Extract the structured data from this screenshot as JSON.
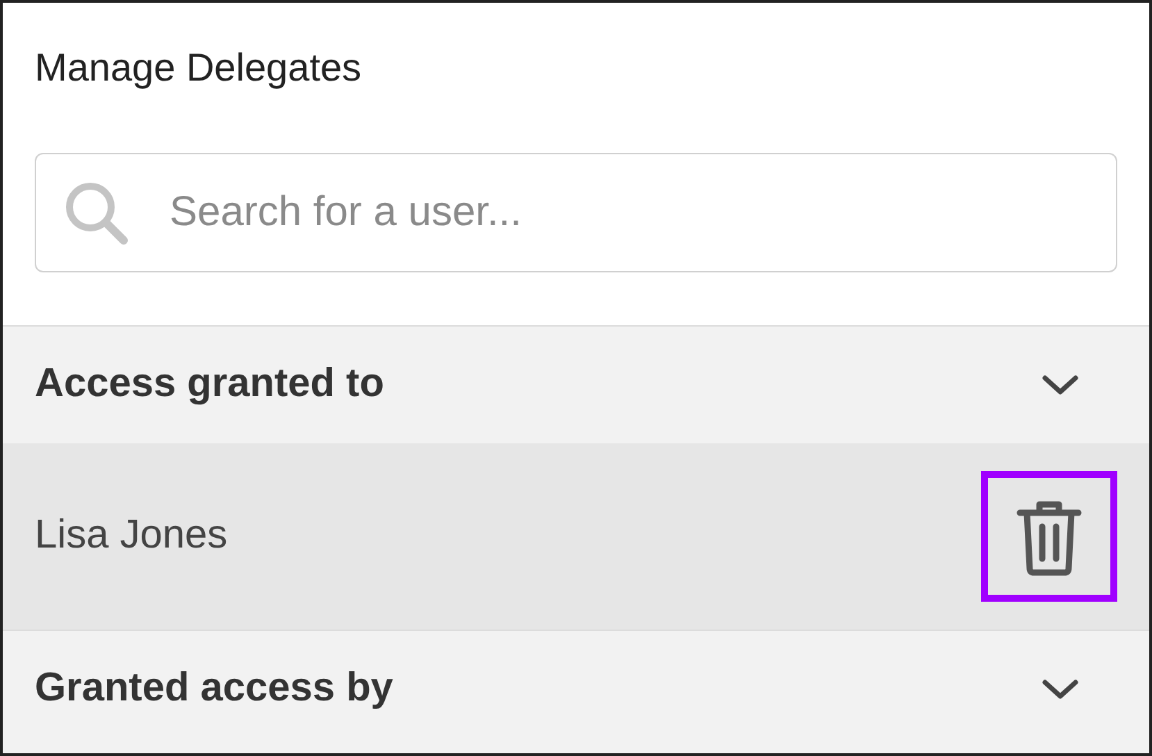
{
  "panel": {
    "title": "Manage Delegates"
  },
  "search": {
    "placeholder": "Search for a user..."
  },
  "sections": [
    {
      "label": "Access granted to",
      "people": [
        {
          "name": "Lisa Jones",
          "highlighted": true
        }
      ]
    },
    {
      "label": "Granted access by"
    }
  ]
}
